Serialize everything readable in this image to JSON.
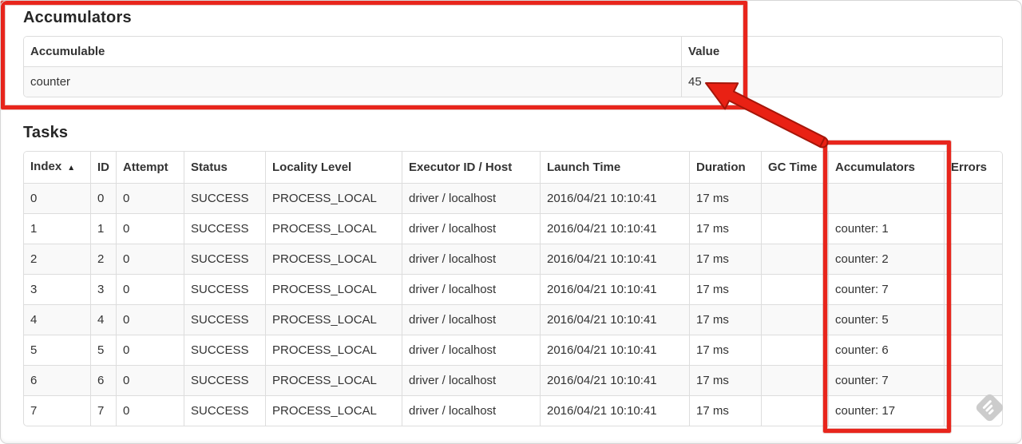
{
  "theme": {
    "annotation_red": "#e8251c",
    "annotation_red_fill": "#e92114",
    "annotation_red_outline": "#a51509",
    "table_border_color": "#dddddd",
    "stripe_row_color": "#f9f9f9",
    "text_color": "#333333",
    "watermark_gray": "#cccccc"
  },
  "accumulators_section": {
    "heading": "Accumulators",
    "columns": [
      "Accumulable",
      "Value"
    ],
    "rows": [
      {
        "accumulable": "counter",
        "value": "45"
      }
    ]
  },
  "tasks_section": {
    "heading": "Tasks",
    "sort_icon": "▲",
    "columns": [
      "Index",
      "ID",
      "Attempt",
      "Status",
      "Locality Level",
      "Executor ID / Host",
      "Launch Time",
      "Duration",
      "GC Time",
      "Accumulators",
      "Errors"
    ],
    "rows": [
      [
        "0",
        "0",
        "0",
        "SUCCESS",
        "PROCESS_LOCAL",
        "driver / localhost",
        "2016/04/21 10:10:41",
        "17 ms",
        "",
        "",
        ""
      ],
      [
        "1",
        "1",
        "0",
        "SUCCESS",
        "PROCESS_LOCAL",
        "driver / localhost",
        "2016/04/21 10:10:41",
        "17 ms",
        "",
        "counter: 1",
        ""
      ],
      [
        "2",
        "2",
        "0",
        "SUCCESS",
        "PROCESS_LOCAL",
        "driver / localhost",
        "2016/04/21 10:10:41",
        "17 ms",
        "",
        "counter: 2",
        ""
      ],
      [
        "3",
        "3",
        "0",
        "SUCCESS",
        "PROCESS_LOCAL",
        "driver / localhost",
        "2016/04/21 10:10:41",
        "17 ms",
        "",
        "counter: 7",
        ""
      ],
      [
        "4",
        "4",
        "0",
        "SUCCESS",
        "PROCESS_LOCAL",
        "driver / localhost",
        "2016/04/21 10:10:41",
        "17 ms",
        "",
        "counter: 5",
        ""
      ],
      [
        "5",
        "5",
        "0",
        "SUCCESS",
        "PROCESS_LOCAL",
        "driver / localhost",
        "2016/04/21 10:10:41",
        "17 ms",
        "",
        "counter: 6",
        ""
      ],
      [
        "6",
        "6",
        "0",
        "SUCCESS",
        "PROCESS_LOCAL",
        "driver / localhost",
        "2016/04/21 10:10:41",
        "17 ms",
        "",
        "counter: 7",
        ""
      ],
      [
        "7",
        "7",
        "0",
        "SUCCESS",
        "PROCESS_LOCAL",
        "driver / localhost",
        "2016/04/21 10:10:41",
        "17 ms",
        "",
        "counter: 17",
        ""
      ]
    ]
  }
}
